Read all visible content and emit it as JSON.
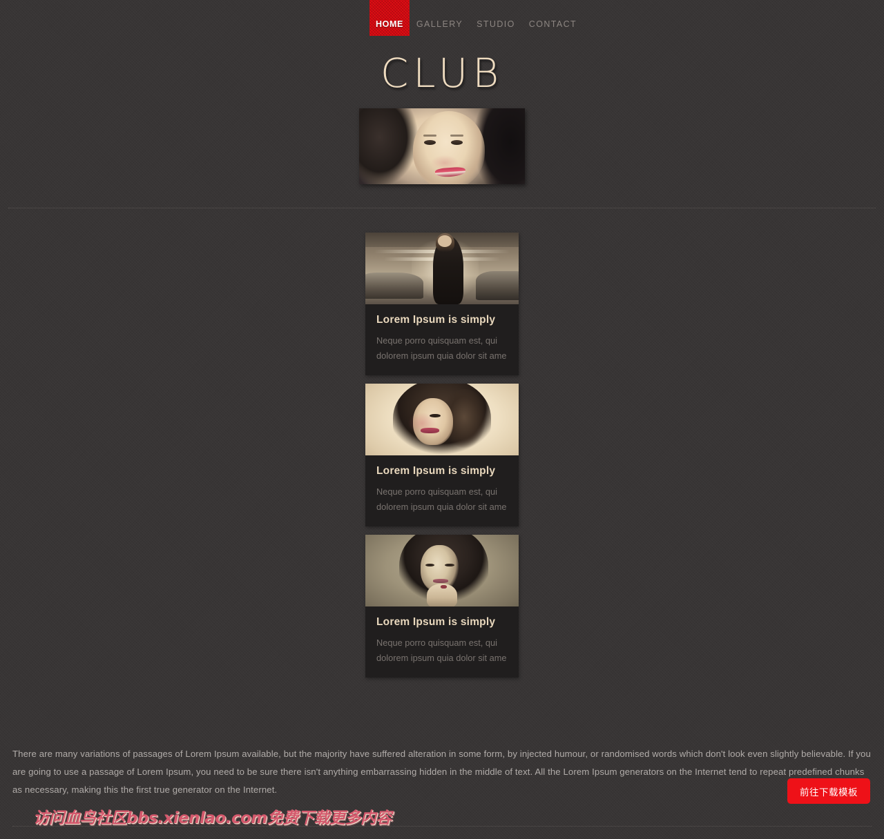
{
  "nav": {
    "items": [
      {
        "label": "HOME",
        "active": true
      },
      {
        "label": "GALLERY",
        "active": false
      },
      {
        "label": "STUDIO",
        "active": false
      },
      {
        "label": "CONTACT",
        "active": false
      }
    ]
  },
  "logo": {
    "text": "CLUB"
  },
  "hero": {
    "image_alt": "smiling-woman-portrait-sepia"
  },
  "cards": [
    {
      "image_alt": "woman-standing-in-parking-garage",
      "title": "Lorem Ipsum is simply",
      "text": "Neque porro quisquam est, qui dolorem ipsum quia dolor sit ame"
    },
    {
      "image_alt": "curly-haired-woman-portrait-cream-background",
      "title": "Lorem Ipsum is simply",
      "text": "Neque porro quisquam est, qui dolorem ipsum quia dolor sit ame"
    },
    {
      "image_alt": "woman-with-hand-on-chin-portrait",
      "title": "Lorem Ipsum is simply",
      "text": "Neque porro quisquam est, qui dolorem ipsum quia dolor sit ame"
    }
  ],
  "footer": {
    "paragraph": "There are many variations of passages of Lorem Ipsum available, but the majority have suffered alteration in some form, by injected humour, or randomised words which don't look even slightly believable. If you are going to use a passage of Lorem Ipsum, you need to be sure there isn't anything embarrassing hidden in the middle of text. All the Lorem Ipsum generators on the Internet tend to repeat predefined chunks as necessary, making this the first true generator on the Internet.",
    "download_label": "前往下载模板"
  },
  "watermark": {
    "text": "访问血鸟社区bbs.xienlao.com免费下载更多内容"
  },
  "colors": {
    "page_background": "#383535",
    "card_background": "#201e1e",
    "accent_red": "#e00d14",
    "button_red": "#ee1118",
    "heading_cream": "#e9d8bd",
    "body_gray": "#79736f",
    "nav_gray": "#8d8682",
    "watermark_pink": "#d4596d"
  }
}
